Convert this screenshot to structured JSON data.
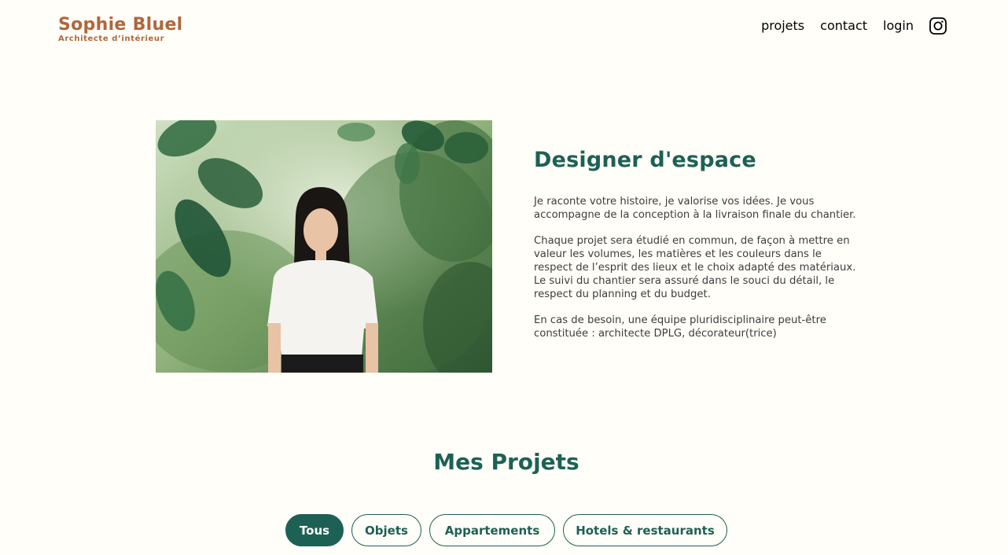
{
  "header": {
    "brand_name": "Sophie Bluel",
    "brand_subtitle": "Architecte d’intérieur",
    "nav": [
      {
        "label": "projets"
      },
      {
        "label": "contact"
      },
      {
        "label": "login"
      }
    ],
    "instagram_icon": "instagram-icon"
  },
  "intro": {
    "photo_alt": "Sophie Bluel",
    "title": "Designer d'espace",
    "paragraphs": [
      "Je raconte votre histoire, je valorise vos idées. Je vous accompagne de la conception à la livraison finale du chantier.",
      "Chaque projet sera étudié en commun, de façon à mettre en valeur les volumes, les matières et les couleurs dans le respect de l’esprit des lieux et le choix adapté des matériaux. Le suivi du chantier sera assuré dans le souci du détail, le respect du planning et du budget.",
      "En cas de besoin, une équipe pluridisciplinaire peut-être constituée : architecte DPLG, décorateur(trice)"
    ]
  },
  "projects": {
    "title": "Mes Projets",
    "filters": [
      {
        "label": "Tous",
        "active": true
      },
      {
        "label": "Objets",
        "active": false
      },
      {
        "label": "Appartements",
        "active": false
      },
      {
        "label": "Hotels & restaurants",
        "active": false
      }
    ]
  },
  "colors": {
    "brand": "#B1663C",
    "accent": "#1D6154",
    "background": "#FFFEF8",
    "text": "#3D3D3D"
  }
}
